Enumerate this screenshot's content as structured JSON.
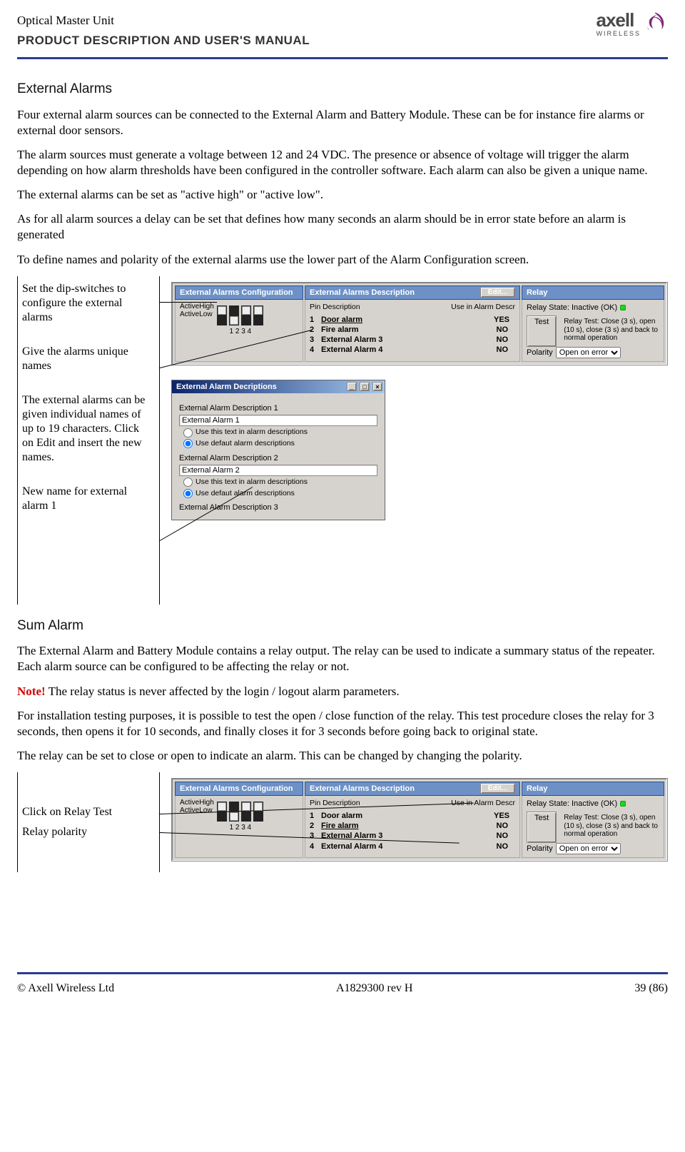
{
  "header": {
    "line1": "Optical Master Unit",
    "line2": "PRODUCT DESCRIPTION AND USER'S MANUAL",
    "logo_text": "axell",
    "logo_sub": "WIRELESS"
  },
  "section_external": {
    "title": "External Alarms",
    "p1": "Four external alarm sources can be connected to the External Alarm and Battery Module. These can be for instance fire alarms or external door sensors.",
    "p2": "The alarm sources must generate a voltage between 12 and 24 VDC. The presence or absence of voltage will trigger the alarm depending on how alarm thresholds have been configured in the controller software. Each alarm can also be given a unique name.",
    "p3": "The external alarms can be set as \"active high\" or \"active low\".",
    "p4": "As for all alarm sources a delay can be set that defines how many seconds an alarm should be in error state before an alarm is generated",
    "p5": "To define names and polarity of the external alarms use the lower part of the Alarm Configuration screen."
  },
  "anno1": {
    "a": "Set the dip-switches to configure the external alarms",
    "b": "Give the alarms unique names",
    "c": "The external alarms can be given individual names of up to 19 characters. Click on Edit and insert the new names.",
    "d": "New name for external alarm 1"
  },
  "cfg_panel": {
    "group1_title": "External Alarms Configuration",
    "active_high": "ActiveHigh",
    "active_low": "ActiveLow",
    "dip_numbers": "1   2   3   4",
    "group2_title": "External Alarms Description",
    "edit_btn": "Edit...",
    "pin_header_l": "Pin Description",
    "pin_header_r": "Use in Alarm Descr",
    "pins": [
      {
        "n": "1",
        "d": "Door alarm",
        "u": "YES"
      },
      {
        "n": "2",
        "d": "Fire alarm",
        "u": "NO"
      },
      {
        "n": "3",
        "d": "External Alarm 3",
        "u": "NO"
      },
      {
        "n": "4",
        "d": "External Alarm 4",
        "u": "NO"
      }
    ],
    "group3_title": "Relay",
    "relay_state": "Relay State: Inactive (OK)",
    "test_btn": "Test",
    "relay_note": "Relay Test: Close (3 s), open (10 s), close (3 s) and back to normal operation",
    "polarity_label": "Polarity",
    "polarity_value": "Open on error"
  },
  "dlg": {
    "title": "External Alarm Decriptions",
    "sec1_label": "External Alarm Description 1",
    "sec1_value": "External Alarm 1",
    "radio_a": "Use this text in alarm descriptions",
    "radio_b": "Use defaut alarm descriptions",
    "sec2_label": "External Alarm Description 2",
    "sec2_value": "External Alarm 2",
    "sec3_label": "External Alarm Description 3"
  },
  "section_sum": {
    "title": "Sum Alarm",
    "p1": "The External Alarm and Battery Module contains a relay output. The relay can be used to indicate a summary status of the repeater. Each alarm source can be configured to be affecting the relay or not.",
    "note_prefix": "Note!",
    "p2_rest": " The relay status is never affected by the login / logout alarm parameters.",
    "p3": "For installation testing purposes, it is possible to test the open / close function of the relay. This test procedure closes the relay for 3 seconds, then opens it for 10 seconds, and finally closes it for 3 seconds before going back to original state.",
    "p4": "The relay can be set to close or open to indicate an alarm. This can be changed by changing the polarity."
  },
  "anno2": {
    "a": "Click on Relay Test",
    "b": "Relay polarity"
  },
  "footer": {
    "left": "© Axell Wireless Ltd",
    "center": "A1829300 rev H",
    "right": "39 (86)"
  }
}
